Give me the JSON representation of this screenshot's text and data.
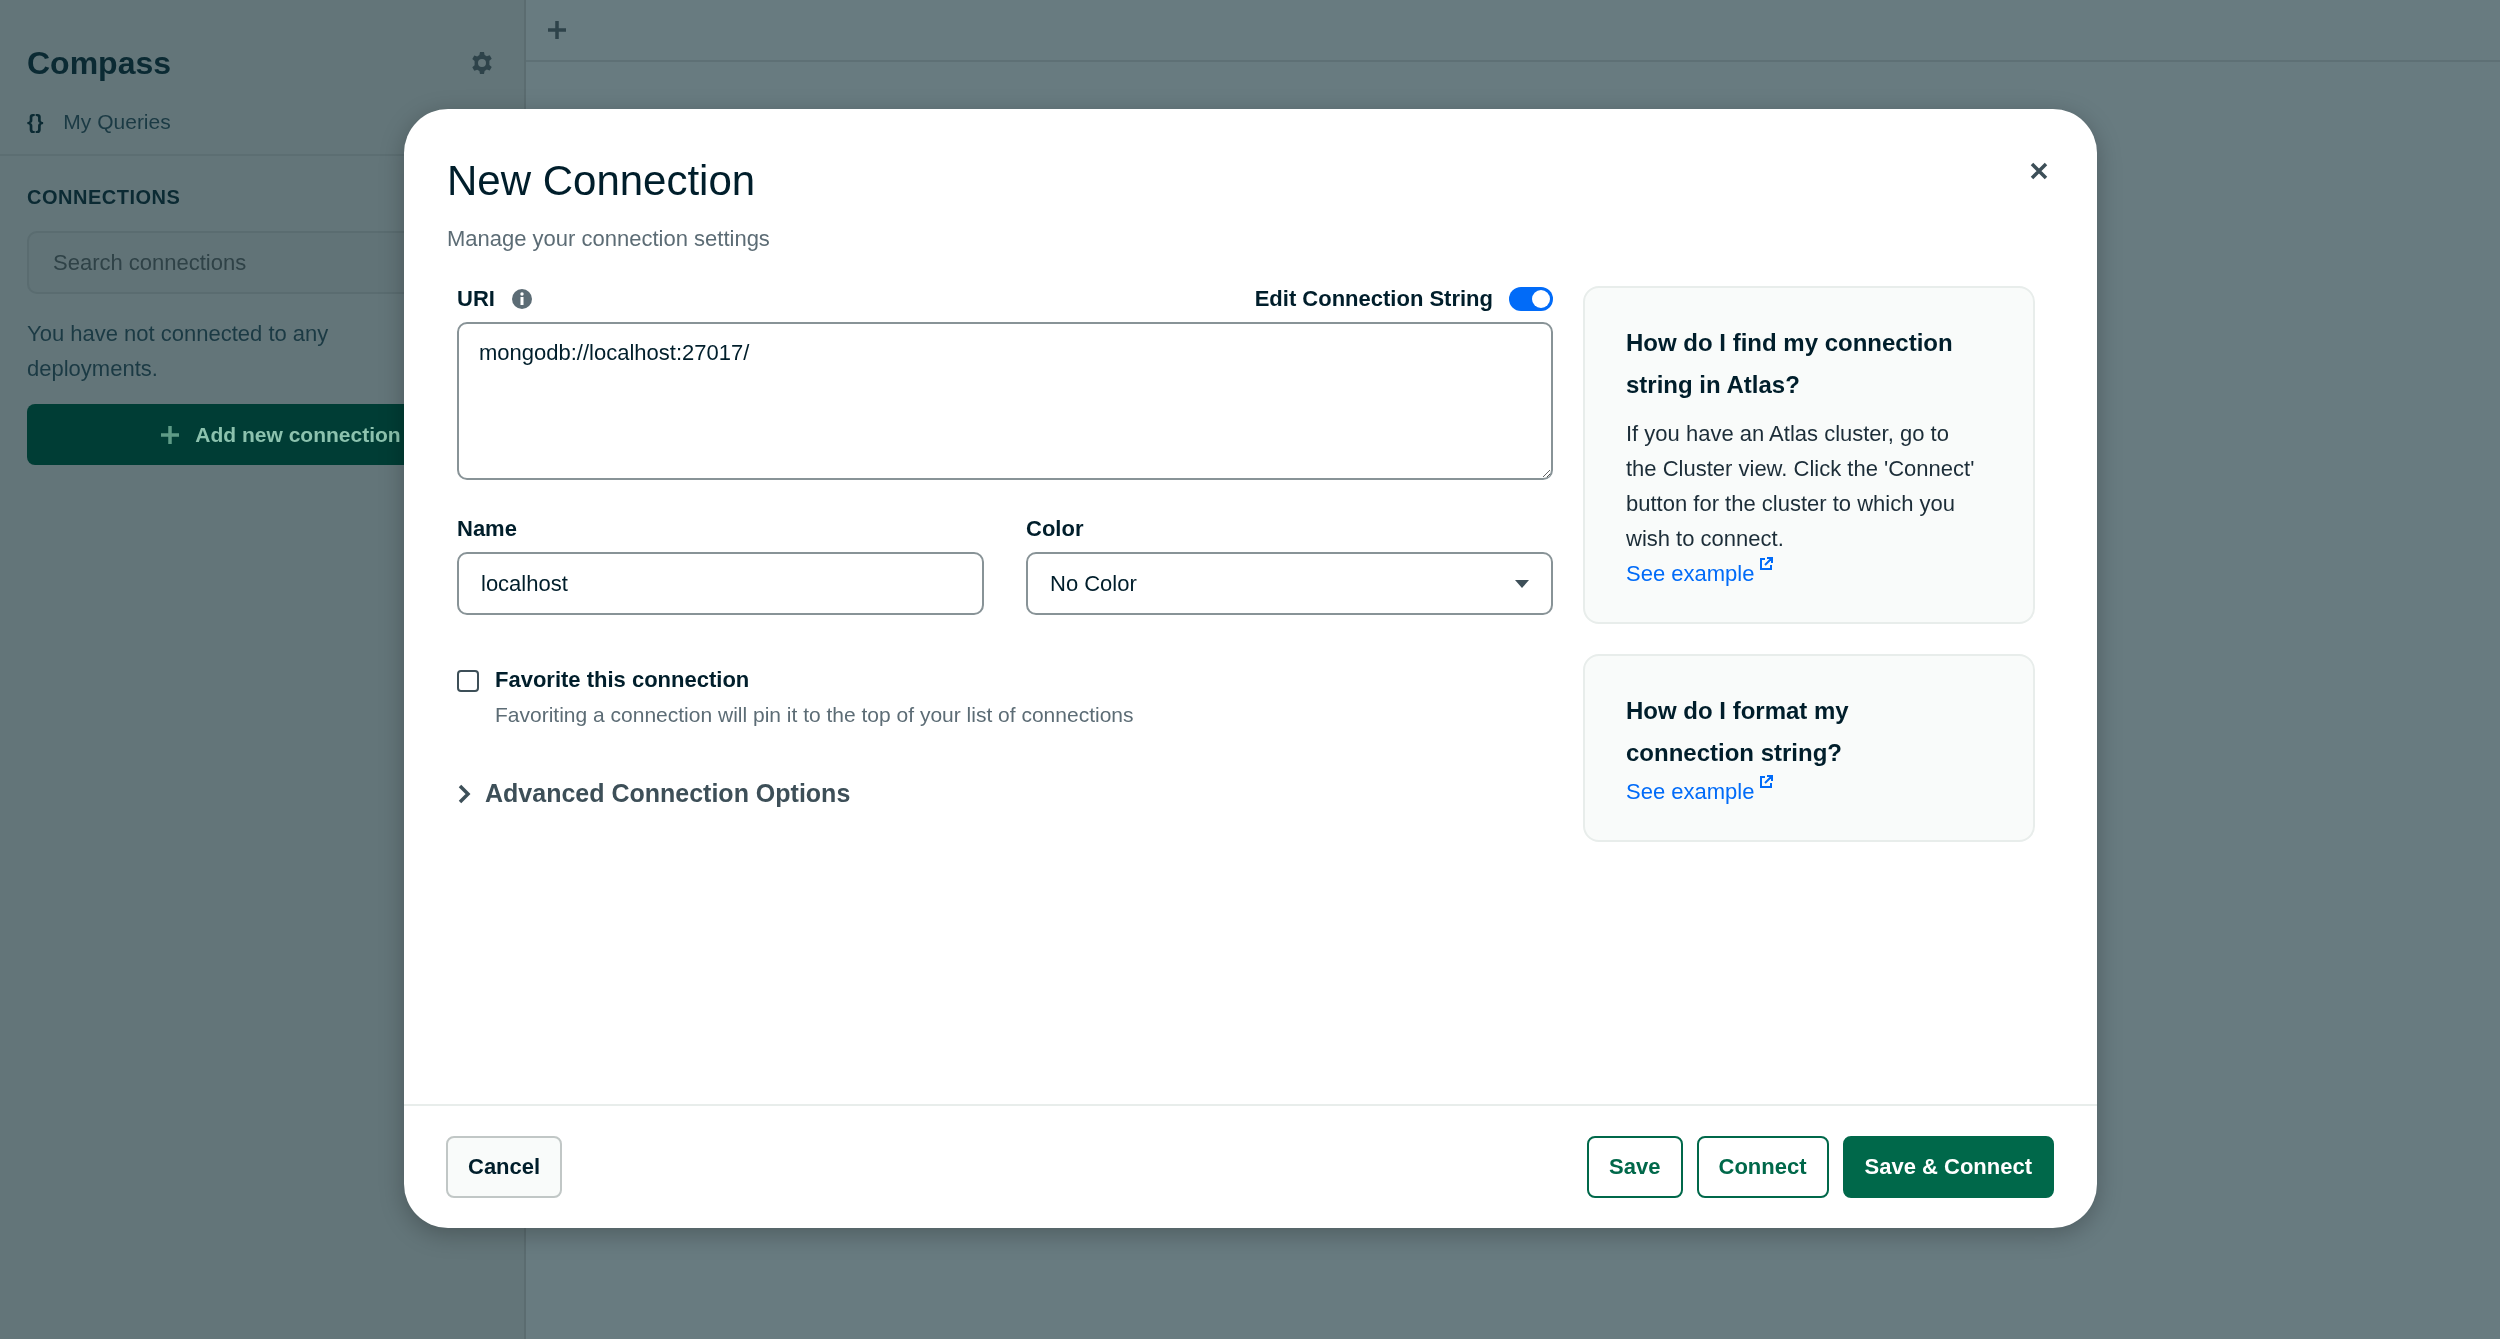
{
  "sidebar": {
    "title": "Compass",
    "nav_items": [
      {
        "icon": "{}",
        "label": "My Queries"
      }
    ],
    "connections_header": "CONNECTIONS",
    "search": {
      "placeholder": "Search connections"
    },
    "empty_message": "You have not connected to any deployments.",
    "add_button": "Add new connection"
  },
  "dialog": {
    "title": "New Connection",
    "subtitle": "Manage your connection settings",
    "uri": {
      "label": "URI",
      "value": "mongodb://localhost:27017/"
    },
    "edit_toggle": {
      "label": "Edit Connection String",
      "on": true
    },
    "name": {
      "label": "Name",
      "value": "localhost"
    },
    "color": {
      "label": "Color",
      "value": "No Color"
    },
    "favorite": {
      "label": "Favorite this connection",
      "description": "Favoriting a connection will pin it to the top of your list of connections",
      "checked": false
    },
    "advanced": {
      "label": "Advanced Connection Options",
      "expanded": false
    },
    "help_cards": [
      {
        "title": "How do I find my connection string in Atlas?",
        "body": "If you have an Atlas cluster, go to the Cluster view. Click the 'Connect' button for the cluster to which you wish to connect.",
        "link": "See example"
      },
      {
        "title": "How do I format my connection string?",
        "link": "See example"
      }
    ],
    "buttons": [
      {
        "label": "Cancel",
        "kind": "secondary"
      },
      {
        "label": "Save",
        "kind": "outline"
      },
      {
        "label": "Connect",
        "kind": "outline"
      },
      {
        "label": "Save & Connect",
        "kind": "primary"
      }
    ]
  }
}
